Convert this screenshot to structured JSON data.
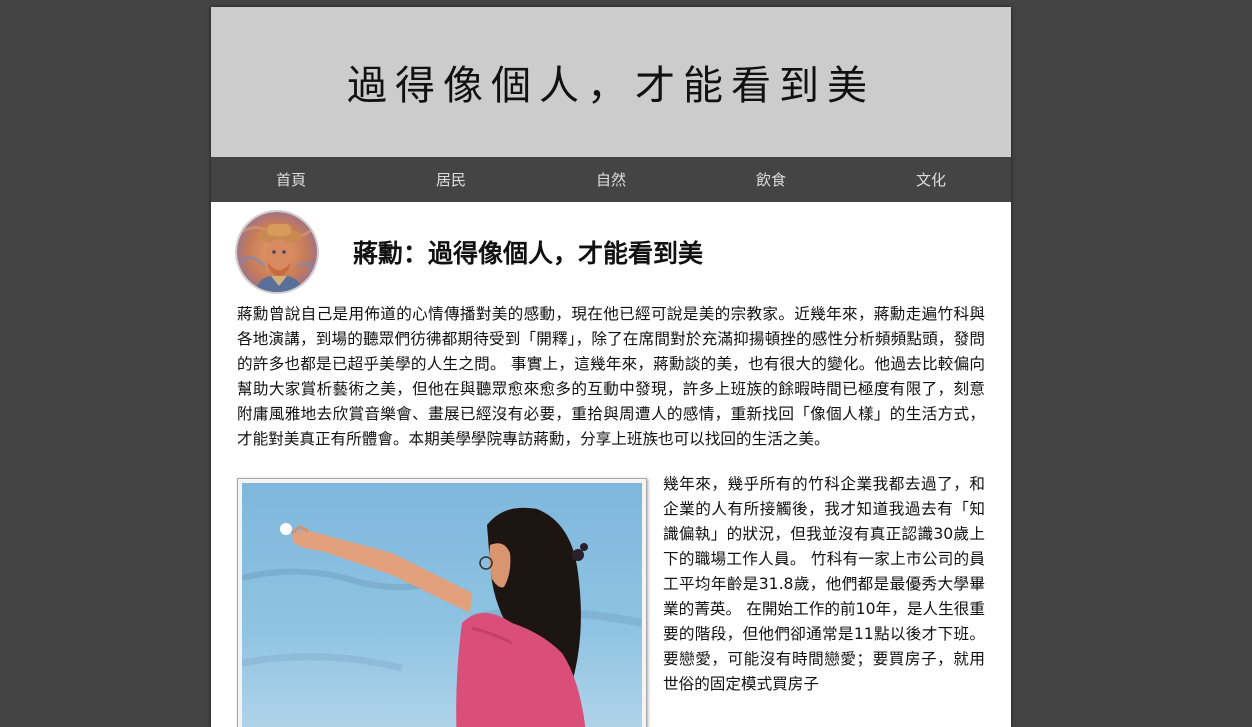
{
  "banner": {
    "title": "過得像個人，才能看到美"
  },
  "nav": {
    "items": [
      {
        "label": "首頁"
      },
      {
        "label": "居民"
      },
      {
        "label": "自然"
      },
      {
        "label": "飲食"
      },
      {
        "label": "文化"
      }
    ]
  },
  "article": {
    "title": "蔣勳：過得像個人，才能看到美",
    "lead": "蔣勳曾說自己是用佈道的心情傳播對美的感動，現在他已經可說是美的宗教家。近幾年來，蔣勳走遍竹科與各地演講，到場的聽眾們彷彿都期待受到「開釋」，除了在席間對於充滿抑揚頓挫的感性分析頻頻點頭，發問的許多也都是已超乎美學的人生之問。 事實上，這幾年來，蔣勳談的美，也有很大的變化。他過去比較偏向幫助大家賞析藝術之美，但他在與聽眾愈來愈多的互動中發現，許多上班族的餘暇時間已極度有限了，刻意附庸風雅地去欣賞音樂會、畫展已經沒有必要，重拾與周遭人的感情，重新找回「像個人樣」的生活方式，才能對美真正有所體會。本期美學學院專訪蔣勳，分享上班族也可以找回的生活之美。",
    "body": "幾年來，幾乎所有的竹科企業我都去過了，和企業的人有所接觸後，我才知道我過去有「知識偏執」的狀況，但我並沒有真正認識30歲上下的職場工作人員。 竹科有一家上市公司的員工平均年齡是31.8歲，他們都是最優秀大學畢業的菁英。 在開始工作的前10年，是人生很重要的階段，但他們卻通常是11點以後才下班。要戀愛，可能沒有時間戀愛；要買房子，就用世俗的固定模式買房子"
  },
  "colors": {
    "background": "#444444",
    "banner": "#cccccc",
    "nav": "#444444",
    "nav_text": "#dddddd",
    "page": "#ffffff"
  }
}
